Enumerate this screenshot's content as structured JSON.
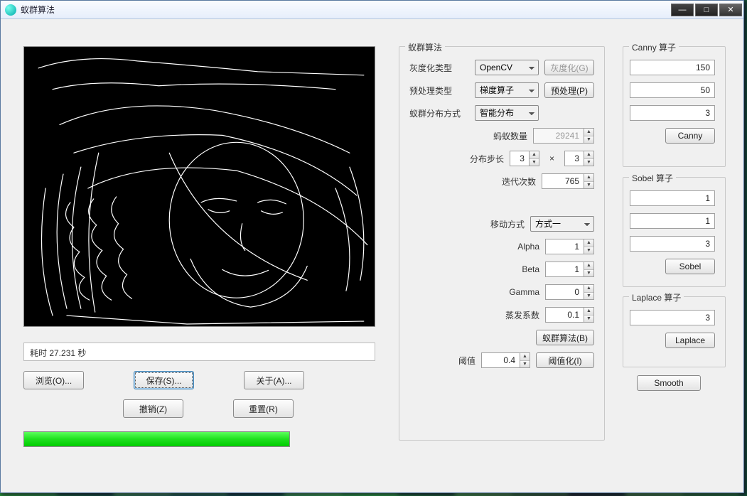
{
  "window": {
    "title": "蚁群算法"
  },
  "status_text": "耗时 27.231 秒",
  "buttons": {
    "browse": "浏览(O)...",
    "save": "保存(S)...",
    "about": "关于(A)...",
    "undo": "撤销(Z)",
    "reset": "重置(R)"
  },
  "aco": {
    "legend": "蚁群算法",
    "gray_label": "灰度化类型",
    "gray_value": "OpenCV",
    "gray_btn": "灰度化(G)",
    "pre_label": "预处理类型",
    "pre_value": "梯度算子",
    "pre_btn": "预处理(P)",
    "dist_label": "蚁群分布方式",
    "dist_value": "智能分布",
    "ants_label": "蚂蚁数量",
    "ants_value": "29241",
    "step_label": "分布步长",
    "step_x": "3",
    "step_y": "3",
    "iter_label": "迭代次数",
    "iter_value": "765",
    "move_label": "移动方式",
    "move_value": "方式一",
    "alpha_label": "Alpha",
    "alpha": "1",
    "beta_label": "Beta",
    "beta": "1",
    "gamma_label": "Gamma",
    "gamma": "0",
    "evap_label": "蒸发系数",
    "evap": "0.1",
    "run_btn": "蚁群算法(B)",
    "thr_label": "阈值",
    "thr": "0.4",
    "thr_btn": "阈值化(I)"
  },
  "canny": {
    "legend": "Canny 算子",
    "v1": "150",
    "v2": "50",
    "v3": "3",
    "btn": "Canny"
  },
  "sobel": {
    "legend": "Sobel 算子",
    "v1": "1",
    "v2": "1",
    "v3": "3",
    "btn": "Sobel"
  },
  "laplace": {
    "legend": "Laplace 算子",
    "v1": "3",
    "btn": "Laplace"
  },
  "smooth_btn": "Smooth"
}
